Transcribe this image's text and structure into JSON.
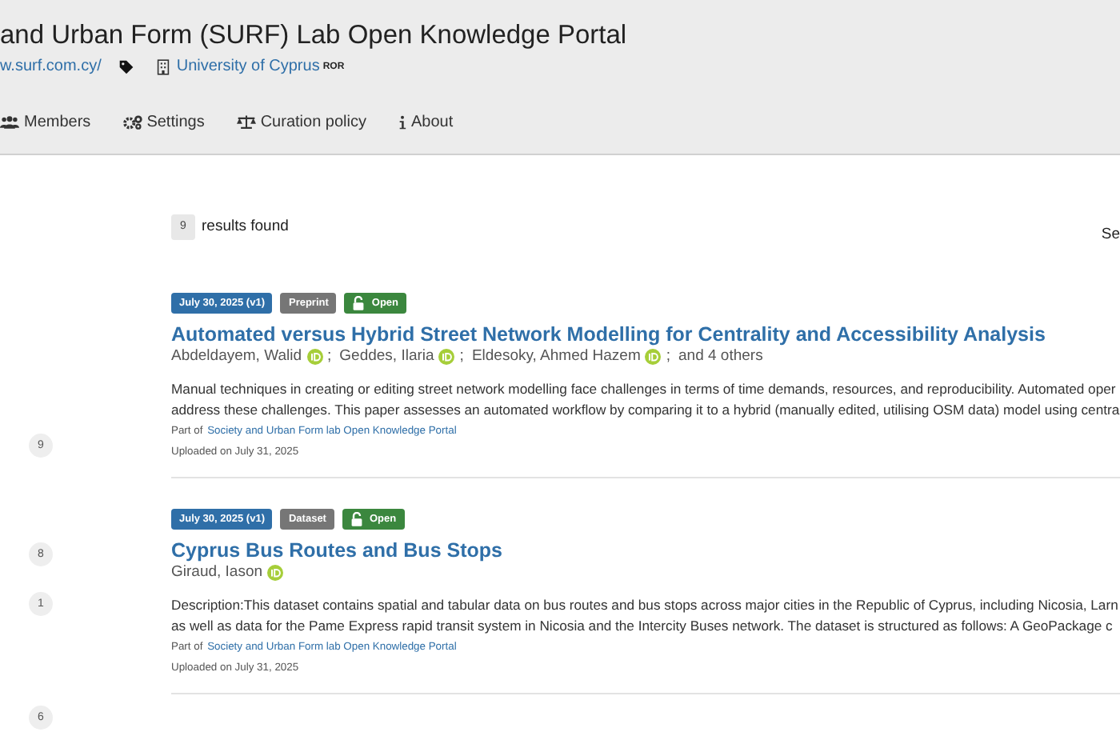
{
  "header": {
    "title": "and Urban Form (SURF) Lab Open Knowledge Portal",
    "website": "w.surf.com.cy/",
    "affiliation": "University of Cyprus",
    "ror": "ROR"
  },
  "nav": [
    {
      "kind": "members",
      "label": "Members"
    },
    {
      "kind": "settings",
      "label": "Settings"
    },
    {
      "kind": "curation",
      "label": "Curation policy"
    },
    {
      "kind": "about",
      "label": "About"
    }
  ],
  "results": {
    "count": "9",
    "label": "results found",
    "sort_partial": "Se"
  },
  "facet_counts": [
    "9",
    "8",
    "1",
    "6"
  ],
  "records": [
    {
      "date": "July 30, 2025 (v1)",
      "type": "Preprint",
      "access": "Open",
      "title": "Automated versus Hybrid Street Network Modelling for Centrality and Accessibility Analysis",
      "separator": ";",
      "authors": [
        {
          "name": "Abdeldayem, Walid",
          "orcid": true
        },
        {
          "name": "Geddes, Ilaria",
          "orcid": true
        },
        {
          "name": "Eldesoky, Ahmed Hazem",
          "orcid": true
        }
      ],
      "more": "and 4 others",
      "description_lines": [
        "Manual techniques in creating or editing street network modelling face challenges in terms of time demands, resources, and reproducibility. Automated oper",
        "address these challenges. This paper assesses an automated workflow by comparing it to a hybrid (manually edited, utilising OSM data) model using centra"
      ],
      "part_of": "Part of",
      "community": "Society and Urban Form lab Open Knowledge Portal",
      "uploaded": "Uploaded on July 31, 2025"
    },
    {
      "date": "July 30, 2025 (v1)",
      "type": "Dataset",
      "access": "Open",
      "title": "Cyprus Bus Routes and Bus Stops",
      "authors": [
        {
          "name": "Giraud, Iason",
          "orcid": true
        }
      ],
      "description_lines": [
        "Description:This dataset contains spatial and tabular data on bus routes and bus stops across major cities in the Republic of Cyprus, including Nicosia, Larn",
        "as well as data for the Pame Express rapid transit system in Nicosia and the Intercity Buses network. The dataset is structured as follows: A GeoPackage c"
      ],
      "part_of": "Part of",
      "community": "Society and Urban Form lab Open Knowledge Portal",
      "uploaded": "Uploaded on July 31, 2025"
    }
  ]
}
